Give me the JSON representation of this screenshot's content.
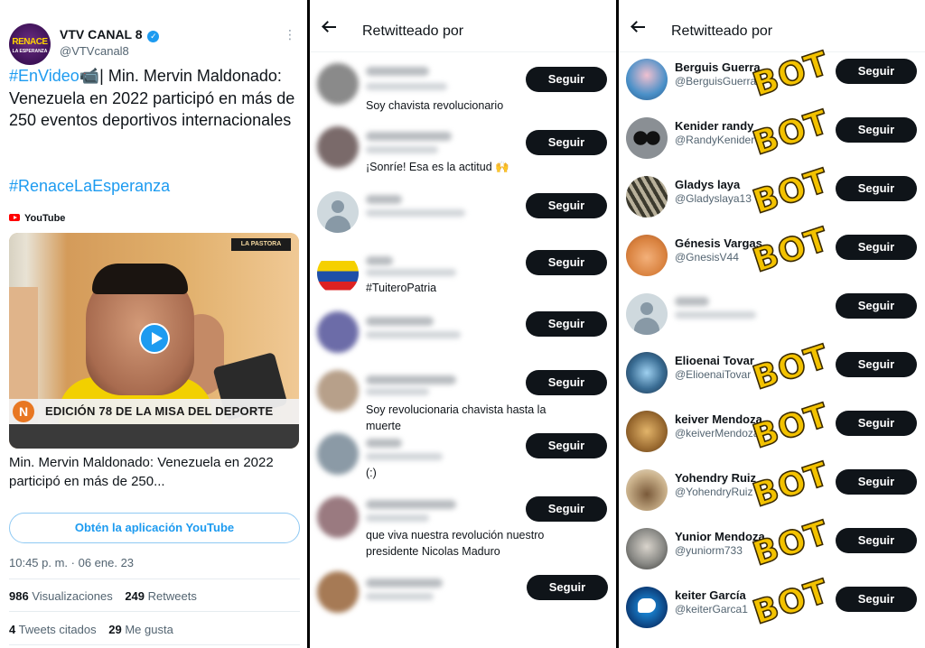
{
  "tweet": {
    "account_name": "VTV CANAL 8",
    "handle": "@VTVcanal8",
    "avatar_text": "RENACE",
    "avatar_subtext": "LA ESPERANZA",
    "hashtag1": "#EnVideo📹",
    "text": "| Min. Mervin Maldonado: Venezuela en 2022 participó en más de 250 eventos deportivos internacionales",
    "hashtag2": "#RenaceLaEsperanza",
    "source": "YouTube",
    "video_badge": "LA PASTORA",
    "video_logo_letter": "N",
    "video_banner": "EDICIÓN 78 DE LA MISA DEL DEPORTE",
    "card_caption": "Min. Mervin Maldonado: Venezuela en 2022 participó en más de 250...",
    "get_app_button": "Obtén la aplicación YouTube",
    "timestamp": "10:45 p. m. · 06 ene. 23",
    "views_count": "986",
    "views_label": "Visualizaciones",
    "retweets_count": "249",
    "retweets_label": "Retweets",
    "quotes_count": "4",
    "quotes_label": "Tweets citados",
    "likes_count": "29",
    "likes_label": "Me gusta"
  },
  "retweeters_left": {
    "title": "Retwitteado por",
    "follow_label": "Seguir",
    "bios": [
      "Soy chavista revolucionario",
      "¡Sonríe! Esa es la actitud 🙌",
      "",
      "#TuiteroPatria",
      "",
      "Soy revolucionaria chavista hasta la muerte",
      "(:)",
      "que viva nuestra revolución nuestro presidente Nicolas Maduro",
      ""
    ]
  },
  "retweeters_right": {
    "title": "Retwitteado por",
    "follow_label": "Seguir",
    "bot_label": "BOT",
    "users": [
      {
        "name": "Berguis Guerra",
        "handle": "@BerguisGuerra"
      },
      {
        "name": "Kenider randy",
        "handle": "@RandyKenider"
      },
      {
        "name": "Gladys laya",
        "handle": "@Gladyslaya13"
      },
      {
        "name": "Génesis Vargas",
        "handle": "@GnesisV44"
      },
      {
        "name": "",
        "handle": ""
      },
      {
        "name": "Elioenai Tovar",
        "handle": "@ElioenaiTovar"
      },
      {
        "name": "keiver Mendoza",
        "handle": "@keiverMendoza"
      },
      {
        "name": "Yohendry Ruiz",
        "handle": "@YohendryRuiz"
      },
      {
        "name": "Yunior Mendoza",
        "handle": "@yuniorm733"
      },
      {
        "name": "keiter García",
        "handle": "@keiterGarca1"
      }
    ]
  },
  "colors": {
    "accent": "#1d9bf0",
    "follow_button": "#0f1419",
    "bot_stamp": "#f3c200"
  }
}
